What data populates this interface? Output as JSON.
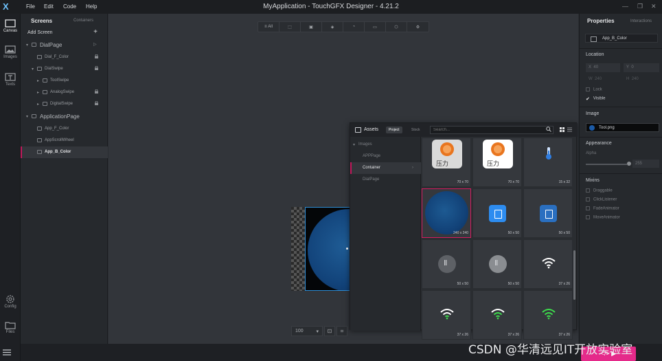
{
  "window": {
    "title": "MyApplication - TouchGFX Designer - 4.21.2"
  },
  "menu": [
    "File",
    "Edit",
    "Code",
    "Help"
  ],
  "leftbar": {
    "items": [
      {
        "label": "Canvas",
        "icon": "canvas-icon"
      },
      {
        "label": "Images",
        "icon": "images-icon"
      },
      {
        "label": "Texts",
        "icon": "texts-icon"
      }
    ],
    "bottom": [
      {
        "label": "Config",
        "icon": "gear-icon"
      },
      {
        "label": "Files",
        "icon": "folder-icon"
      }
    ]
  },
  "screens": {
    "tab_screens": "Screens",
    "tab_containers": "Containers",
    "add_label": "Add Screen",
    "tree": [
      {
        "label": "DialPage",
        "level": 0
      },
      {
        "label": "Dial_F_Color",
        "level": 1
      },
      {
        "label": "DialSwipe",
        "level": 1
      },
      {
        "label": "ToolSwipe",
        "level": 2
      },
      {
        "label": "AnalogSwipe",
        "level": 2
      },
      {
        "label": "DigitalSwipe",
        "level": 2
      },
      {
        "label": "ApplicationPage",
        "level": 0
      },
      {
        "label": "App_F_Color",
        "level": 1
      },
      {
        "label": "AppScrollWheel",
        "level": 1
      },
      {
        "label": "App_B_Color",
        "level": 1,
        "selected": true
      }
    ]
  },
  "canvas": {
    "toolbar_all": "All",
    "zoom": "100"
  },
  "assets": {
    "title": "Assets",
    "tab_project": "Project",
    "tab_stock": "Stock",
    "search_placeholder": "Search...",
    "tree": {
      "root": "Images",
      "folders": [
        "APPPage",
        "Container",
        "DialPage"
      ],
      "active": "Container"
    },
    "cells": [
      {
        "size": "70 x 70",
        "kind": "pressure-gray",
        "text": "压力"
      },
      {
        "size": "70 x 70",
        "kind": "pressure-white",
        "text": "压力"
      },
      {
        "size": "15 x 32",
        "kind": "thermometer"
      },
      {
        "size": "240 x 240",
        "kind": "circle",
        "selected": true
      },
      {
        "size": "50 x 50",
        "kind": "chip"
      },
      {
        "size": "50 x 50",
        "kind": "chip-dim"
      },
      {
        "size": "50 x 50",
        "kind": "disk"
      },
      {
        "size": "50 x 50",
        "kind": "disk-light"
      },
      {
        "size": "37 x 26",
        "kind": "wifi-white"
      },
      {
        "size": "37 x 26",
        "kind": "wifi-green"
      },
      {
        "size": "37 x 26",
        "kind": "wifi-green"
      },
      {
        "size": "37 x 26",
        "kind": "wifi-green-bright"
      }
    ]
  },
  "properties": {
    "tab_properties": "Properties",
    "tab_interactions": "Interactions",
    "widget_name": "App_B_Color",
    "location": {
      "title": "Location",
      "x_label": "X",
      "x": "40",
      "y_label": "Y",
      "y": "0",
      "w_label": "W",
      "w": "240",
      "h_label": "H",
      "h": "240",
      "lock": "Lock",
      "visible": "Visible"
    },
    "image": {
      "title": "Image",
      "value": "Tool.png"
    },
    "appearance": {
      "title": "Appearance",
      "alpha_label": "Alpha",
      "alpha": "255"
    },
    "mixins": {
      "title": "Mixins",
      "items": [
        "Draggable",
        "ClickListener",
        "FadeAnimator",
        "MoveAnimator"
      ]
    }
  },
  "watermark": "CSDN @华清远见IT开放实验室",
  "colors": {
    "accent": "#c2185b",
    "run": "#e52a8a",
    "selection": "#2d8dd6"
  }
}
